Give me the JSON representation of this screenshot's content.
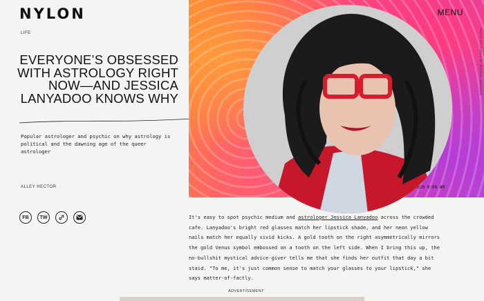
{
  "brand": {
    "logo": "NYLON"
  },
  "nav": {
    "menu_label": "MENU"
  },
  "article": {
    "section": "LIFE",
    "headline": "EVERYONE’S OBSESSED WITH ASTROLOGY RIGHT NOW—AND JESSICA LANYADOO KNOWS WHY",
    "dek": "Popular astrologer and psychic on why astrology is political and the dawning age of the queer astrologer",
    "author": "ALLEY HECTOR",
    "date": "1.28.2020 9:00 AM",
    "photo_credit": "PHOTO COURTESY OF JESSICA LANYADOO",
    "body_before_link": "It's easy to spot psychic medium and ",
    "body_link": "astrologer Jessica Lanyadoo",
    "body_after_link": " across the crowded cafe. Lanyadoo's bright red glasses match her lipstick shade, and her neon yellow nails match her equally vivid kicks. A gold tooth on the right asymmetrically mirrors the gold Venus symbol embossed on a tooth on the left side. When I bring this up, the no-bullshit mystical advice-giver tells me that she finds her outfit that day a bit staid. \"To me, it's just common sense to match your glasses to your lipstick,\" she says matter-of-factly."
  },
  "share": {
    "facebook": "FB",
    "twitter": "TW"
  },
  "ad": {
    "label": "ADVERTISEMENT"
  },
  "icons": [
    "link-icon",
    "mail-icon"
  ],
  "colors": {
    "hero_orange": "#ff8a2c",
    "hero_pink": "#e63b9b",
    "hero_purple": "#b84fd8",
    "glasses_red": "#d91c2c"
  }
}
